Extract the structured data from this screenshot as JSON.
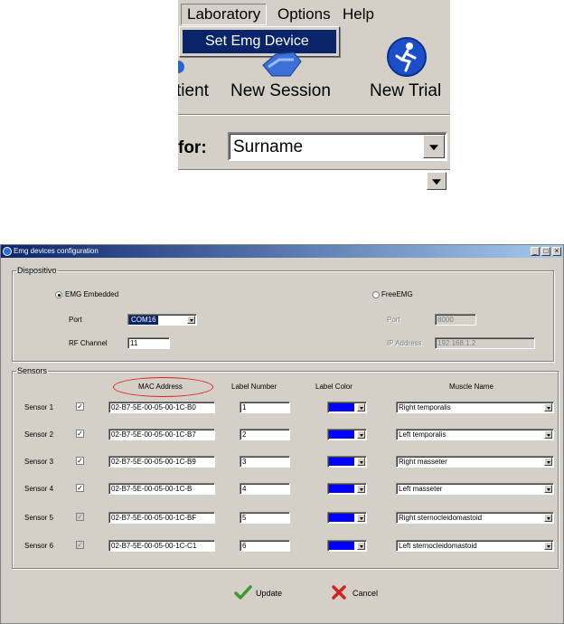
{
  "zoom": {
    "menu": {
      "laboratory": "Laboratory",
      "options": "Options",
      "help": "Help",
      "set_emg_device": "Set Emg Device"
    },
    "toolbar": {
      "patient": "tient",
      "new_session": "New Session",
      "new_trial": "New Trial"
    },
    "search": {
      "label": "for:",
      "value": "Surname"
    }
  },
  "dialog": {
    "title": "Emg devices configuration",
    "controls": {
      "minimize": "_",
      "maximize": "□",
      "close": "×"
    },
    "dispositivo": {
      "legend": "Dispositivo",
      "emg_embedded": "EMG Embedded",
      "free_emg": "FreeEMG",
      "port_label": "Port",
      "port_value": "COM16",
      "rf_label": "RF Channel",
      "rf_value": "11",
      "free_port_label": "Port",
      "free_port_value": "8000",
      "ip_label": "IP Address",
      "ip_value": "192.168.1.2"
    },
    "sensors": {
      "legend": "Sensors",
      "headers": {
        "mac": "MAC Address",
        "label_number": "Label Number",
        "label_color": "Label Color",
        "muscle": "Muscle Name"
      },
      "rows": [
        {
          "name": "Sensor 1",
          "check": "✓",
          "mac": "02-B7-5E-00-05-00-1C-B0",
          "number": "1",
          "muscle": "Right temporalis"
        },
        {
          "name": "Sensor 2",
          "check": "✓",
          "mac": "02-B7-5E-00-05-00-1C-B7",
          "number": "2",
          "muscle": "Left temporalis"
        },
        {
          "name": "Sensor 3",
          "check": "✓",
          "mac": "02-B7-5E-00-05-00-1C-B9",
          "number": "3",
          "muscle": "Right masseter"
        },
        {
          "name": "Sensor 4",
          "check": "✓",
          "mac": "02-B7-5E-00-05-00-1C-B",
          "number": "4",
          "muscle": "Left masseter"
        },
        {
          "name": "Sensor 5",
          "check": "✓",
          "mac": "02-B7-5E-00-05-00-1C-BF",
          "number": "5",
          "muscle": "Right sternocleidomastoid"
        },
        {
          "name": "Sensor 6",
          "check": "✓",
          "mac": "02-B7-5E-00-05-00-1C-C1",
          "number": "6",
          "muscle": "Left sternocleidomastoid"
        }
      ]
    },
    "buttons": {
      "update": "Update",
      "cancel": "Cancel"
    }
  },
  "colors": {
    "label_color": "#0000ff",
    "highlight_oval": "#e0201b",
    "selection": "#0a246a"
  }
}
